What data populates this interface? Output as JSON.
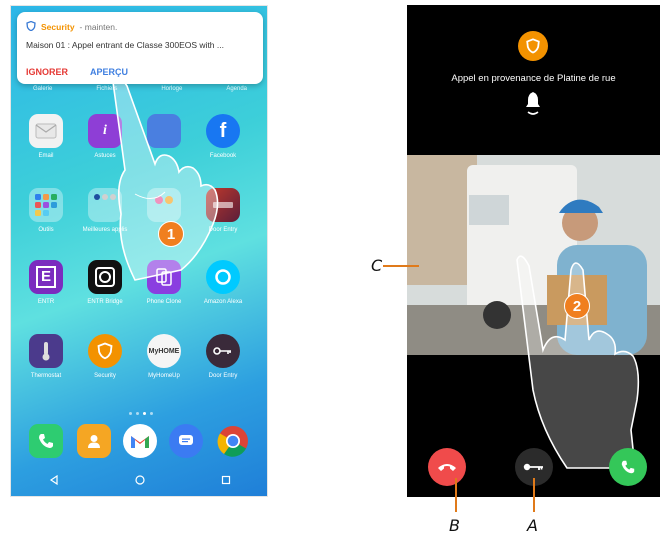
{
  "notification": {
    "app_name": "Security",
    "when": "- mainten.",
    "message": "Maison 01 : Appel entrant de Classe 300EOS with ...",
    "action_ignore": "IGNORER",
    "action_preview": "APERÇU"
  },
  "home": {
    "top_row_labels": [
      "Galerie",
      "Fichiers",
      "Horloge",
      "Agenda"
    ],
    "apps": [
      {
        "label": "Email",
        "icon": "email-icon"
      },
      {
        "label": "Astuces",
        "icon": "tips-icon"
      },
      {
        "label": "",
        "icon": "app-icon"
      },
      {
        "label": "Facebook",
        "icon": "facebook-icon"
      },
      {
        "label": "Outils",
        "icon": "tools-folder-icon"
      },
      {
        "label": "Meilleures applis",
        "icon": "folder-icon"
      },
      {
        "label": "",
        "icon": "folder-icon"
      },
      {
        "label": "Door Entry",
        "icon": "door-entry-icon"
      },
      {
        "label": "ENTR",
        "icon": "entr-icon"
      },
      {
        "label": "ENTR Bridge",
        "icon": "entr-bridge-icon"
      },
      {
        "label": "Phone Clone",
        "icon": "phone-clone-icon"
      },
      {
        "label": "Amazon Alexa",
        "icon": "alexa-icon"
      },
      {
        "label": "Thermostat",
        "icon": "thermostat-icon"
      },
      {
        "label": "Security",
        "icon": "security-icon"
      },
      {
        "label": "MyHomeUp",
        "icon": "myhomeup-icon"
      },
      {
        "label": "Door Entry",
        "icon": "key-icon"
      }
    ],
    "dock": [
      "phone-icon",
      "contacts-icon",
      "gmail-icon",
      "messages-icon",
      "chrome-icon"
    ]
  },
  "call": {
    "title": "Appel en provenance de Platine de rue"
  },
  "steps": {
    "step1": "1",
    "step2": "2"
  },
  "callouts": {
    "a": "A",
    "b": "B",
    "c": "C"
  },
  "colors": {
    "accent_orange": "#f39200",
    "hangup_red": "#f04b4b",
    "answer_green": "#34c759",
    "door_dark": "#2b2b2b",
    "callout_line": "#e07a1a"
  }
}
